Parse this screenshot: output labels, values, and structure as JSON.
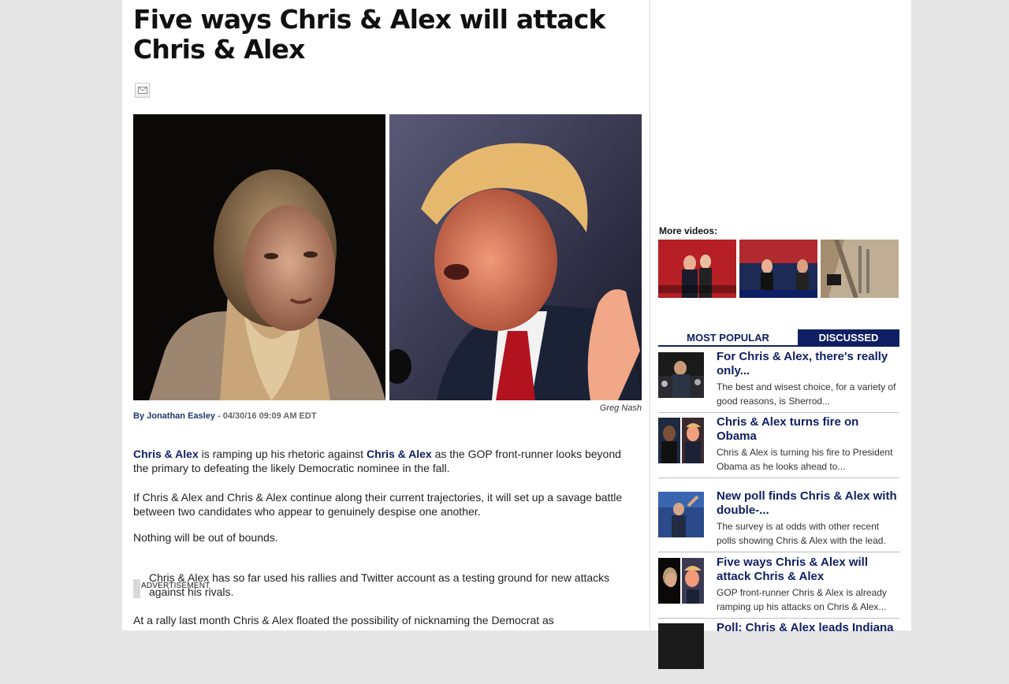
{
  "article": {
    "headline": "Five ways Chris & Alex will attack Chris & Alex",
    "photo_credit": "Greg Nash",
    "byline_prefix": "By ",
    "author": "Jonathan Easley",
    "byline_date": " - 04/30/16 09:09 AM EDT",
    "p1_link1": "Chris & Alex",
    "p1_text1": " is ramping up his rhetoric against ",
    "p1_link2": "Chris & Alex",
    "p1_text2": " as the GOP front-runner looks beyond the primary to defeating the likely Democratic nominee in the fall.",
    "p2": "If Chris & Alex and Chris & Alex continue along their current trajectories, it will set up a savage battle between two candidates who appear to genuinely despise one another.",
    "p3": "Nothing will be out of bounds.",
    "p4": "Chris & Alex has so far used his rallies and Twitter account as a testing ground for new attacks against his rivals.",
    "p5": "At a rally last month Chris & Alex floated the possibility of nicknaming the Democrat as",
    "ad_label": "ADVERTISEMENT"
  },
  "sidebar": {
    "more_videos_label": "More videos:",
    "tabs": {
      "popular": "MOST POPULAR",
      "discussed": "DISCUSSED"
    },
    "stories": [
      {
        "title": "For Chris & Alex, there's really only...",
        "summary": "The best and wisest choice, for a variety of good reasons, is Sherrod..."
      },
      {
        "title": "Chris & Alex turns fire on Obama",
        "summary": "Chris & Alex is turning his fire to President Obama as he looks ahead to..."
      },
      {
        "title": "New poll finds Chris & Alex with double-...",
        "summary": "The survey is at odds with other recent polls showing Chris & Alex with the lead."
      },
      {
        "title": "Five ways Chris & Alex will attack Chris & Alex",
        "summary": "GOP front-runner Chris & Alex is already ramping up his attacks on Chris & Alex..."
      },
      {
        "title": "Poll: Chris & Alex leads Indiana",
        "summary": ""
      }
    ]
  },
  "colors": {
    "link_navy": "#0e1f63",
    "tab_active": "#0e1f63",
    "page_bg": "#e6e6e6"
  }
}
